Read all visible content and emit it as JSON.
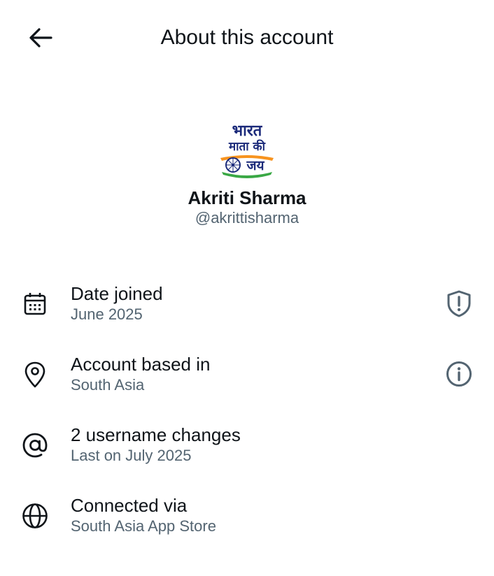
{
  "header": {
    "title": "About this account",
    "back_icon": "arrow-left-icon"
  },
  "profile": {
    "avatar_text_line1": "भारत",
    "avatar_text_line2": "माता की",
    "avatar_text_line3": "जय",
    "display_name": "Akriti Sharma",
    "handle": "@akrittisharma"
  },
  "rows": [
    {
      "icon": "calendar-icon",
      "title": "Date joined",
      "subtitle": "June 2025",
      "action_icon": "shield-alert-icon"
    },
    {
      "icon": "location-pin-icon",
      "title": "Account based in",
      "subtitle": "South Asia",
      "action_icon": "info-icon"
    },
    {
      "icon": "at-sign-icon",
      "title": "2 username changes",
      "subtitle": "Last on July 2025"
    },
    {
      "icon": "globe-icon",
      "title": "Connected via",
      "subtitle": "South Asia App Store"
    }
  ],
  "colors": {
    "primary_text": "#0f1419",
    "secondary_text": "#536471",
    "icon_gray": "#536471",
    "saffron": "#f7931e",
    "green": "#3aa845",
    "navy": "#1b2a7a"
  }
}
